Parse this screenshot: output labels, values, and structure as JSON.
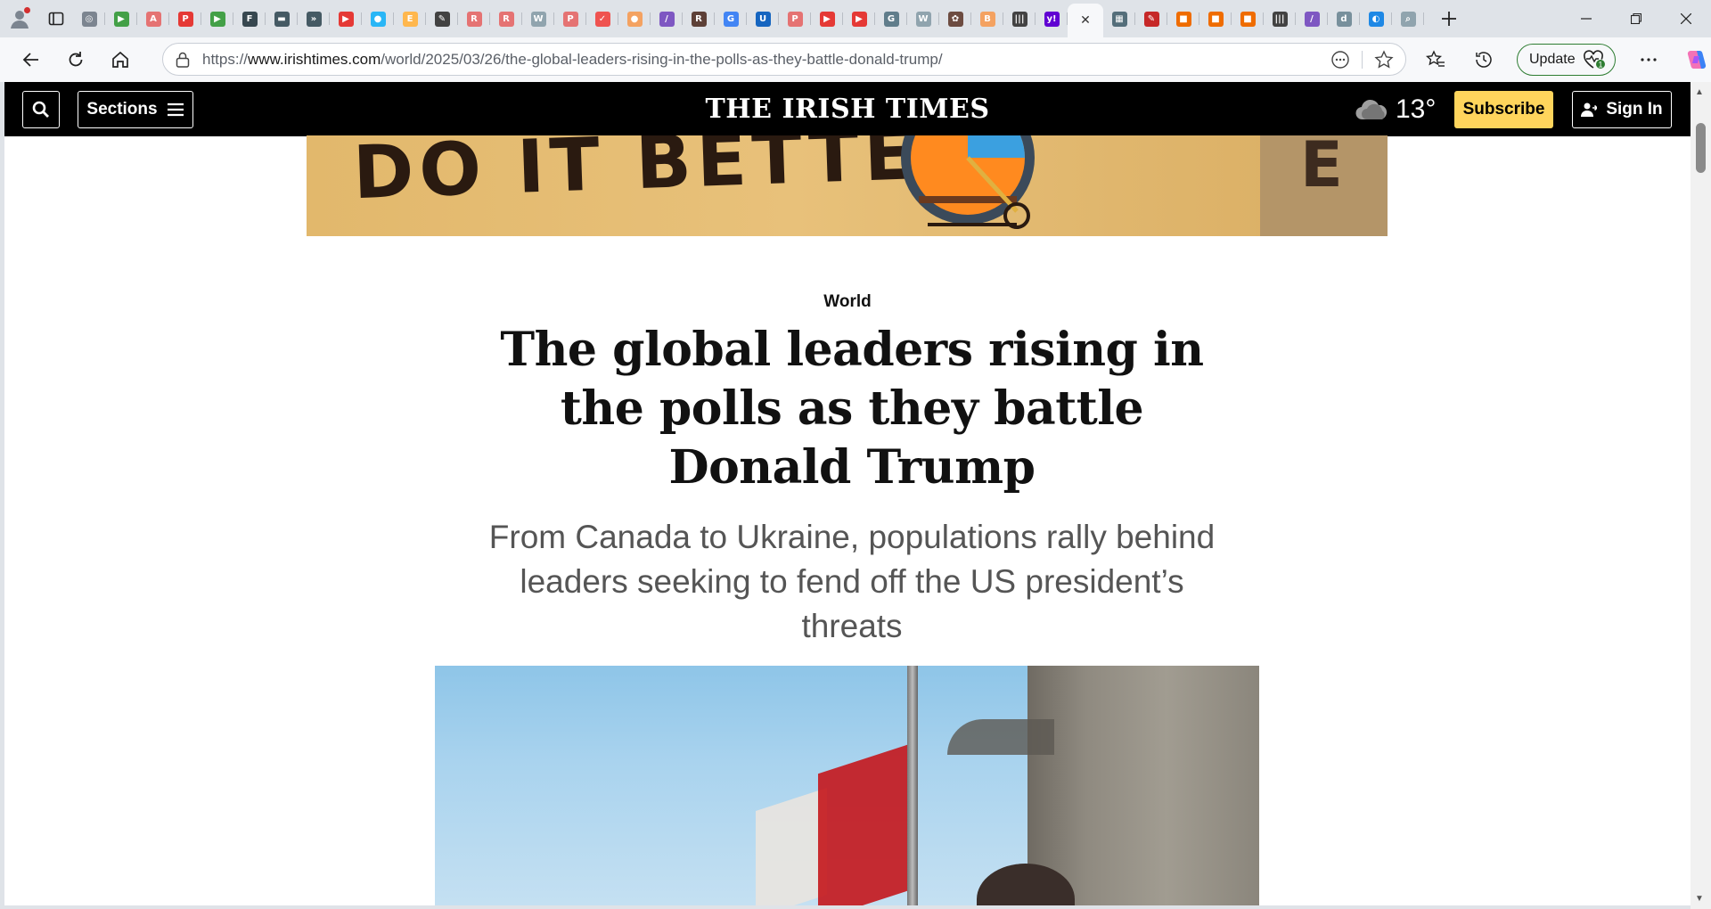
{
  "browser": {
    "tab_favicons": [
      {
        "icon": "globe-icon",
        "color": "#7c8590"
      },
      {
        "icon": "play-icon",
        "color": "#43a047"
      },
      {
        "icon": "letter-a-icon",
        "color": "#e57373"
      },
      {
        "icon": "letter-p-icon",
        "color": "#e53935"
      },
      {
        "icon": "play-icon",
        "color": "#43a047"
      },
      {
        "icon": "fox-news-icon",
        "color": "#37474f"
      },
      {
        "icon": "folder-icon",
        "color": "#455a64"
      },
      {
        "icon": "arrow-icon",
        "color": "#455a64"
      },
      {
        "icon": "youtube-icon",
        "color": "#e53935"
      },
      {
        "icon": "circle-icon",
        "color": "#29b6f6"
      },
      {
        "icon": "letter-e-icon",
        "color": "#ffb74d"
      },
      {
        "icon": "feather-icon",
        "color": "#424242"
      },
      {
        "icon": "letter-r-icon",
        "color": "#e57373"
      },
      {
        "icon": "letter-r-icon",
        "color": "#e57373"
      },
      {
        "icon": "wiki-icon",
        "color": "#90a4ae"
      },
      {
        "icon": "pdf-icon",
        "color": "#e57373"
      },
      {
        "icon": "bird-icon",
        "color": "#ef5350"
      },
      {
        "icon": "circle-icon",
        "color": "#f4a261"
      },
      {
        "icon": "slash-icon",
        "color": "#7e57c2"
      },
      {
        "icon": "letter-r-icon",
        "color": "#5d4037"
      },
      {
        "icon": "google-icon",
        "color": "#4285f4"
      },
      {
        "icon": "ul-icon",
        "color": "#1565c0"
      },
      {
        "icon": "pdf-icon",
        "color": "#e57373"
      },
      {
        "icon": "youtube-icon",
        "color": "#e53935"
      },
      {
        "icon": "youtube-icon",
        "color": "#e53935"
      },
      {
        "icon": "gp-icon",
        "color": "#607d8b"
      },
      {
        "icon": "wiki-icon",
        "color": "#90a4ae"
      },
      {
        "icon": "seal-icon",
        "color": "#6d4c41"
      },
      {
        "icon": "letter-b-icon",
        "color": "#f4a261"
      },
      {
        "icon": "bars-icon",
        "color": "#424242"
      },
      {
        "icon": "yahoo-icon",
        "color": "#6001d2"
      },
      {
        "icon": "close-icon",
        "color": "#333333"
      },
      {
        "icon": "map-icon",
        "color": "#546e7a"
      },
      {
        "icon": "pen-icon",
        "color": "#c62828"
      },
      {
        "icon": "bookmark-icon",
        "color": "#ef6c00"
      },
      {
        "icon": "bookmark-icon",
        "color": "#ef6c00"
      },
      {
        "icon": "bookmark-icon",
        "color": "#ef6c00"
      },
      {
        "icon": "bars-icon",
        "color": "#424242"
      },
      {
        "icon": "slash-icon",
        "color": "#7e57c2"
      },
      {
        "icon": "db-icon",
        "color": "#78909c"
      },
      {
        "icon": "copilot-icon",
        "color": "#1e88e5"
      },
      {
        "icon": "search-icon",
        "color": "#90a4ae"
      }
    ],
    "url_prefix": "https://",
    "url_host": "www.irishtimes.com",
    "url_path": "/world/2025/03/26/the-global-leaders-rising-in-the-polls-as-they-battle-donald-trump/",
    "update_label": "Update",
    "update_badge": "1"
  },
  "site": {
    "sections_label": "Sections",
    "logo": "THE IRISH TIMES",
    "temperature": "13°",
    "subscribe_label": "Subscribe",
    "signin_label": "Sign In"
  },
  "ad": {
    "text": "DO IT BETTER?",
    "sign_letter": "E"
  },
  "article": {
    "kicker": "World",
    "headline": "The global leaders rising in the polls as they battle Donald Trump",
    "standfirst": "From Canada to Ukraine, populations rally behind leaders seeking to fend off the US president’s threats"
  },
  "colors": {
    "header_bg": "#000000",
    "subscribe_bg": "#ffd55c",
    "update_border": "#2e7d32"
  }
}
